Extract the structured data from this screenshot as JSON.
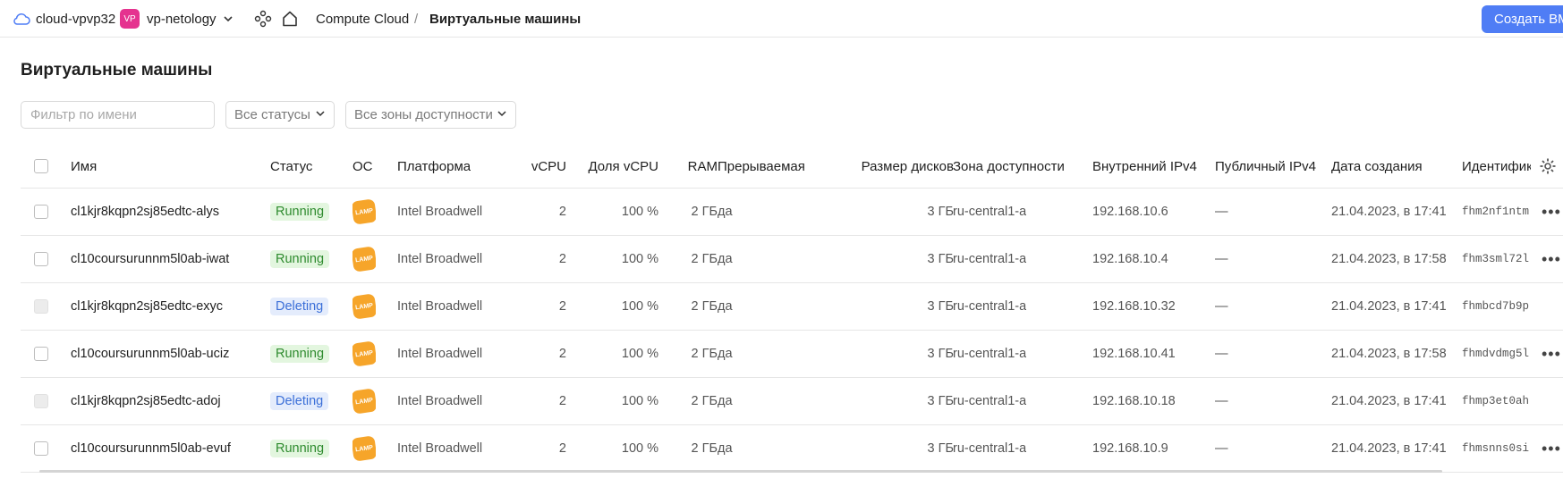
{
  "topbar": {
    "cloud_name": "cloud-vpvp32",
    "folder_badge": "VP",
    "folder_name": "vp-netology",
    "breadcrumb_service": "Compute Cloud",
    "breadcrumb_sep": "/",
    "breadcrumb_page": "Виртуальные машины",
    "create_button": "Создать ВМ",
    "icons": [
      "cloud-icon",
      "chevron-down-icon",
      "services-icon",
      "home-icon"
    ]
  },
  "page": {
    "title": "Виртуальные машины",
    "filter_placeholder": "Фильтр по имени",
    "status_select": "Все статусы",
    "zone_select": "Все зоны доступности"
  },
  "table": {
    "columns": {
      "name": "Имя",
      "status": "Статус",
      "os": "ОС",
      "platform": "Платформа",
      "vcpu": "vCPU",
      "vcpu_share": "Доля vCPU",
      "ram": "RAM",
      "preemptible": "Прерываемая",
      "disk_size": "Размер дисков",
      "zone": "Зона доступности",
      "internal_ip": "Внутренний IPv4",
      "public_ip": "Публичный IPv4",
      "created": "Дата создания",
      "id": "Идентификатор"
    },
    "rows": [
      {
        "name": "cl1kjr8kqpn2sj85edtc-alys",
        "status": "Running",
        "os": "LAMP",
        "platform": "Intel Broadwell",
        "vcpu": "2",
        "vcpu_share": "100 %",
        "ram": "2 ГБ",
        "preemptible": "да",
        "disk_size": "3 ГБ",
        "zone": "ru-central1-a",
        "internal_ip": "192.168.10.6",
        "public_ip": "—",
        "created": "21.04.2023, в 17:41",
        "id": "fhm2nf1ntm"
      },
      {
        "name": "cl10coursurunnm5l0ab-iwat",
        "status": "Running",
        "os": "LAMP",
        "platform": "Intel Broadwell",
        "vcpu": "2",
        "vcpu_share": "100 %",
        "ram": "2 ГБ",
        "preemptible": "да",
        "disk_size": "3 ГБ",
        "zone": "ru-central1-a",
        "internal_ip": "192.168.10.4",
        "public_ip": "—",
        "created": "21.04.2023, в 17:58",
        "id": "fhm3sml72l"
      },
      {
        "name": "cl1kjr8kqpn2sj85edtc-exyc",
        "status": "Deleting",
        "os": "LAMP",
        "platform": "Intel Broadwell",
        "vcpu": "2",
        "vcpu_share": "100 %",
        "ram": "2 ГБ",
        "preemptible": "да",
        "disk_size": "3 ГБ",
        "zone": "ru-central1-a",
        "internal_ip": "192.168.10.32",
        "public_ip": "—",
        "created": "21.04.2023, в 17:41",
        "id": "fhmbcd7b9p"
      },
      {
        "name": "cl10coursurunnm5l0ab-uciz",
        "status": "Running",
        "os": "LAMP",
        "platform": "Intel Broadwell",
        "vcpu": "2",
        "vcpu_share": "100 %",
        "ram": "2 ГБ",
        "preemptible": "да",
        "disk_size": "3 ГБ",
        "zone": "ru-central1-a",
        "internal_ip": "192.168.10.41",
        "public_ip": "—",
        "created": "21.04.2023, в 17:58",
        "id": "fhmdvdmg5l"
      },
      {
        "name": "cl1kjr8kqpn2sj85edtc-adoj",
        "status": "Deleting",
        "os": "LAMP",
        "platform": "Intel Broadwell",
        "vcpu": "2",
        "vcpu_share": "100 %",
        "ram": "2 ГБ",
        "preemptible": "да",
        "disk_size": "3 ГБ",
        "zone": "ru-central1-a",
        "internal_ip": "192.168.10.18",
        "public_ip": "—",
        "created": "21.04.2023, в 17:41",
        "id": "fhmp3et0ah"
      },
      {
        "name": "cl10coursurunnm5l0ab-evuf",
        "status": "Running",
        "os": "LAMP",
        "platform": "Intel Broadwell",
        "vcpu": "2",
        "vcpu_share": "100 %",
        "ram": "2 ГБ",
        "preemptible": "да",
        "disk_size": "3 ГБ",
        "zone": "ru-central1-a",
        "internal_ip": "192.168.10.9",
        "public_ip": "—",
        "created": "21.04.2023, в 17:41",
        "id": "fhmsnns0si"
      }
    ]
  },
  "colors": {
    "accent": "#4f7df5",
    "folder_badge": "#e5338f",
    "running": "#2e8b2e",
    "deleting": "#3b6fd8",
    "os_lamp": "#f6a52a"
  }
}
